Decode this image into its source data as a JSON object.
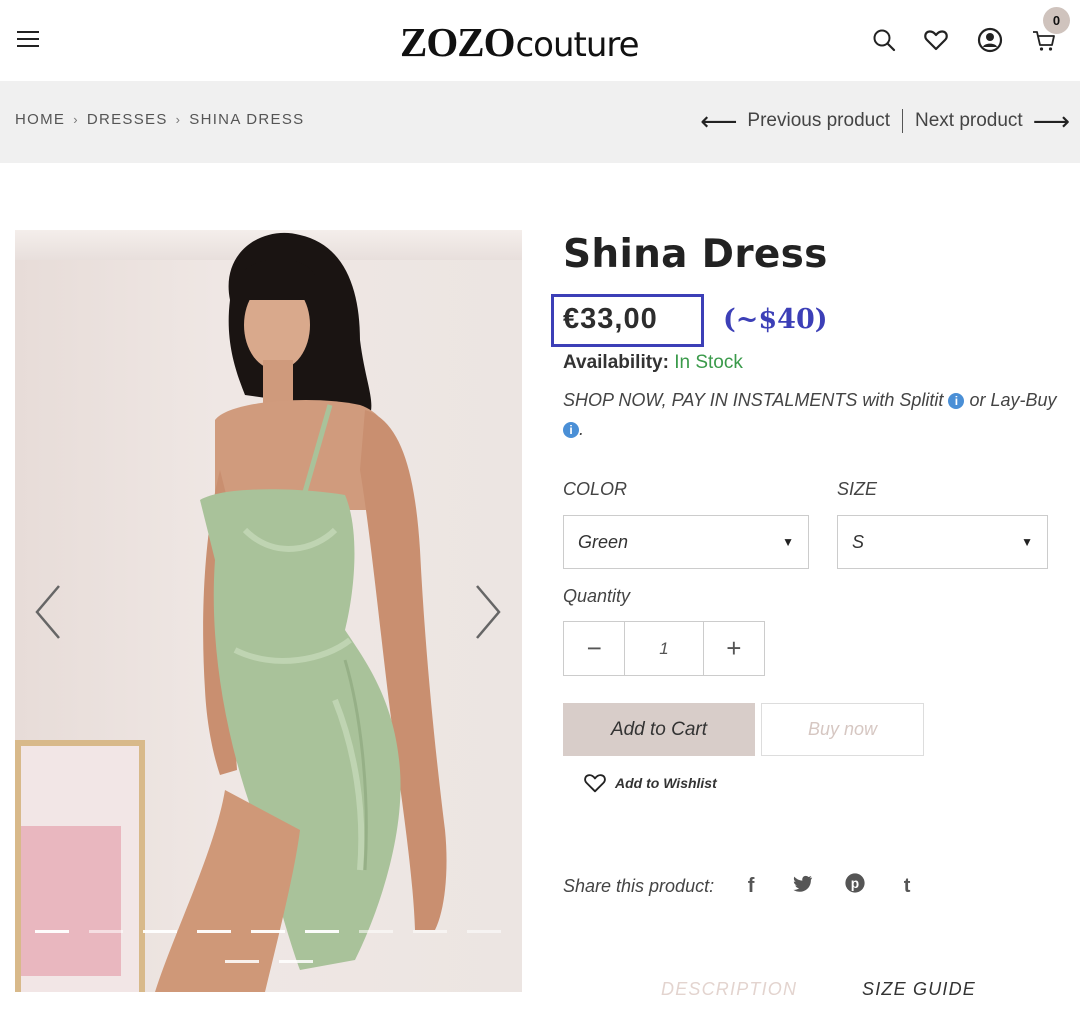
{
  "header": {
    "logo_brand": "ZOZO",
    "logo_sub": "couture",
    "cart_count": "0"
  },
  "breadcrumb": {
    "items": [
      "HOME",
      "DRESSES",
      "SHINA DRESS"
    ],
    "separator": "›"
  },
  "nav": {
    "previous": "Previous product",
    "next": "Next product"
  },
  "product": {
    "title": "Shina Dress",
    "price": "€33,00",
    "price_usd": "(~$40)",
    "availability_label": "Availability:",
    "availability_value": "In Stock",
    "shop_now_text": "SHOP NOW, PAY IN INSTALMENTS with Splitit",
    "shop_now_or": "or Lay-Buy",
    "shop_now_end": ".",
    "info_glyph": "i"
  },
  "options": {
    "color_label": "COLOR",
    "color_value": "Green",
    "size_label": "SIZE",
    "size_value": "S",
    "quantity_label": "Quantity",
    "quantity_value": "1",
    "minus": "−",
    "plus": "+"
  },
  "actions": {
    "add_to_cart": "Add to Cart",
    "buy_now": "Buy now",
    "add_to_wishlist": "Add to Wishlist"
  },
  "share": {
    "label": "Share this product:",
    "icons": [
      "facebook-icon",
      "twitter-icon",
      "pinterest-icon",
      "tumblr-icon"
    ],
    "glyphs": [
      "f",
      "🐦",
      "℗",
      "t"
    ]
  },
  "tabs": {
    "description": "DESCRIPTION",
    "size_guide": "SIZE GUIDE"
  },
  "colors": {
    "accent_blue": "#3c3fb7",
    "stock_green": "#3a9a4a",
    "cart_button": "#d8cdc9",
    "breadcrumb_bg": "#f0f0f0",
    "dress_green": "#a9c29a"
  }
}
